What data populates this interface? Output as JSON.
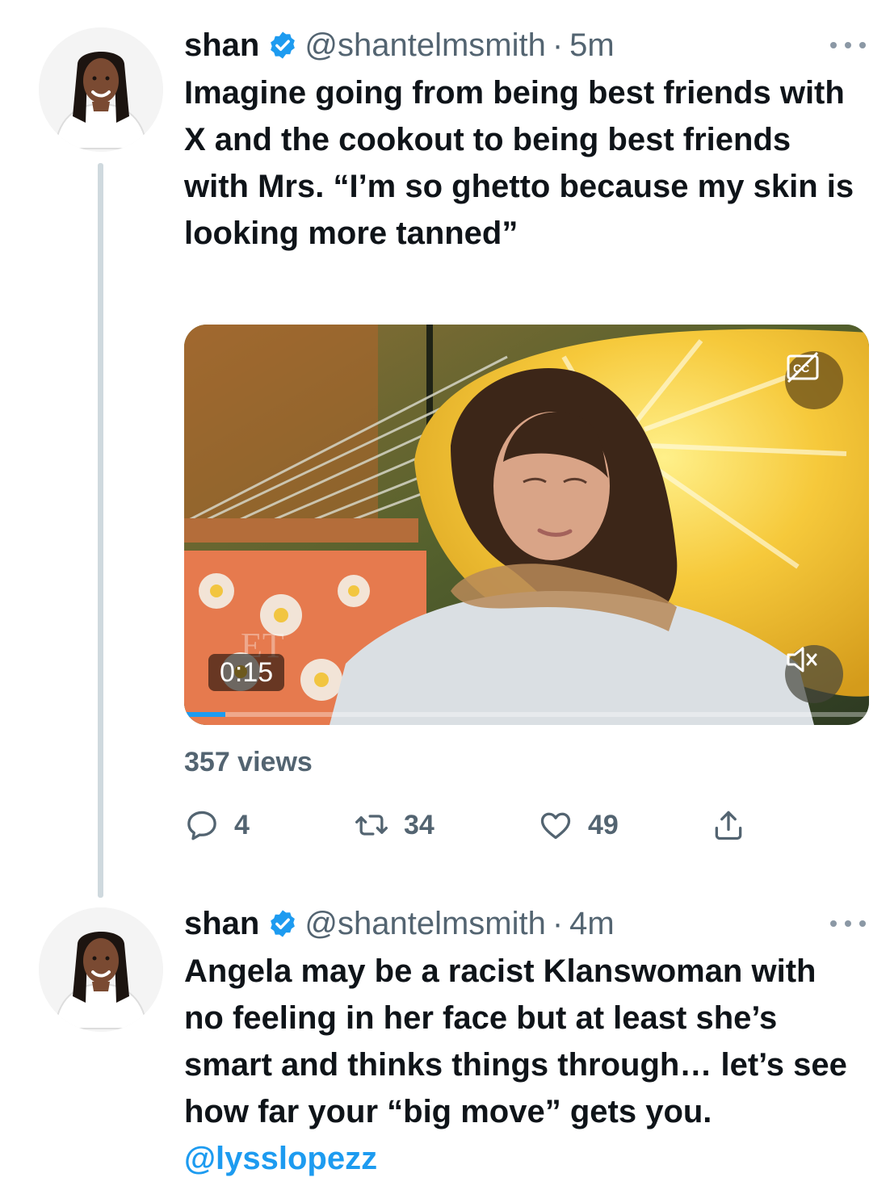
{
  "colors": {
    "text": "#0f1419",
    "secondary": "#536471",
    "verified": "#1d9bf0",
    "mention": "#1d9bf0",
    "thread_line": "#cfd9de"
  },
  "tweets": [
    {
      "name": "shan",
      "handle": "@shantelmsmith",
      "dot": "·",
      "time": "5m",
      "verified_icon": "verified-badge-icon",
      "text": "Imagine going from being best friends with X and the cookout to being best friends with Mrs. “I’m so ghetto because my skin is looking more tanned”",
      "video": {
        "timer": "0:15",
        "cc_icon": "closed-captions-off-icon",
        "mute_icon": "volume-muted-icon",
        "progress_fraction": 0.06
      },
      "views": "357 views",
      "actions": {
        "reply_count": "4",
        "retweet_count": "34",
        "like_count": "49",
        "share_icon": "share-icon"
      }
    },
    {
      "name": "shan",
      "handle": "@shantelmsmith",
      "dot": "·",
      "time": "4m",
      "verified_icon": "verified-badge-icon",
      "text": "Angela may be a racist Klanswoman with no feeling in her face but at least she’s smart and thinks things through… let’s see how far your “big move” gets you. ",
      "mention": "@lysslopezz"
    }
  ]
}
